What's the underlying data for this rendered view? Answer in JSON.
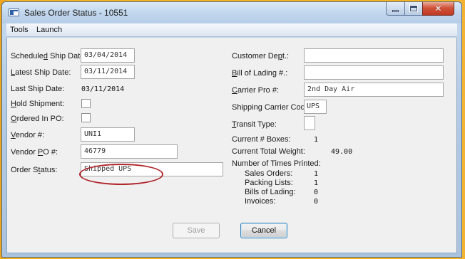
{
  "window": {
    "title": "Sales Order Status - 10551",
    "minimize": "minimize",
    "maximize": "maximize",
    "close_glyph": "✕"
  },
  "menubar": {
    "items": [
      "Tools",
      "Launch"
    ]
  },
  "left": {
    "scheduled_ship_date": {
      "label_pre": "Schedule",
      "label_u": "d",
      "label_post": " Ship Date:",
      "value": "03/04/2014"
    },
    "latest_ship_date": {
      "label_pre": "",
      "label_u": "L",
      "label_post": "atest Ship Date:",
      "value": "03/11/2014"
    },
    "last_ship_date": {
      "label": "Last Ship Date:",
      "value": "03/11/2014"
    },
    "hold_shipment": {
      "label_pre": "",
      "label_u": "H",
      "label_post": "old Shipment:",
      "checked": false
    },
    "ordered_in_po": {
      "label_pre": "",
      "label_u": "O",
      "label_post": "rdered In PO:",
      "checked": false
    },
    "vendor_num": {
      "label_pre": "",
      "label_u": "V",
      "label_post": "endor #:",
      "value": "UNI1"
    },
    "vendor_po_num": {
      "label_pre": "Vendor ",
      "label_u": "P",
      "label_post": "O #:",
      "value": "46779"
    },
    "order_status": {
      "label_pre": "Order S",
      "label_u": "t",
      "label_post": "atus:",
      "value": "Shipped UPS"
    }
  },
  "right": {
    "customer_dept": {
      "label_pre": "Customer De",
      "label_u": "p",
      "label_post": "t.:",
      "value": ""
    },
    "bill_of_lading": {
      "label_pre": "",
      "label_u": "B",
      "label_post": "ill of Lading #.:",
      "value": ""
    },
    "carrier_pro": {
      "label_pre": "",
      "label_u": "C",
      "label_post": "arrier Pro #:",
      "value": "2nd Day Air"
    },
    "shipping_carrier_code": {
      "label": "Shipping Carrier Code:",
      "value": "UPS"
    },
    "transit_type": {
      "label_pre": "",
      "label_u": "T",
      "label_post": "ransit Type:",
      "value": ""
    },
    "current_boxes": {
      "label": "Current # Boxes:",
      "value": "1"
    },
    "current_total_weight": {
      "label": "Current Total Weight:",
      "value": "49.00"
    },
    "times_printed": {
      "label": "Number of Times Printed:",
      "rows": [
        {
          "label": "Sales Orders:",
          "value": "1"
        },
        {
          "label": "Packing Lists:",
          "value": "1"
        },
        {
          "label": "Bills of Lading:",
          "value": "0"
        },
        {
          "label": "Invoices:",
          "value": "0"
        }
      ]
    }
  },
  "buttons": {
    "save": {
      "label": "Save",
      "enabled": false
    },
    "cancel": {
      "label": "Cancel",
      "enabled": true
    }
  },
  "colors": {
    "annotation_circle": "#b0262d",
    "desktop": "#f5b321"
  }
}
